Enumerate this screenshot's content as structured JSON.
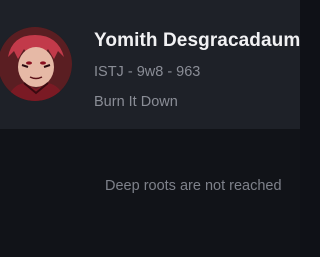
{
  "profile": {
    "name": "Yomith Desgracadaum",
    "personality_line": "ISTJ - 9w8 - 963",
    "status": "Burn It Down",
    "avatar_icon": "anime-character-avatar"
  },
  "feed": {
    "empty_message": "Deep roots are not reached"
  },
  "colors": {
    "background": "#111318",
    "card": "#1e2128",
    "name_text": "#f1f1f3",
    "secondary_text": "#8a8d96"
  }
}
